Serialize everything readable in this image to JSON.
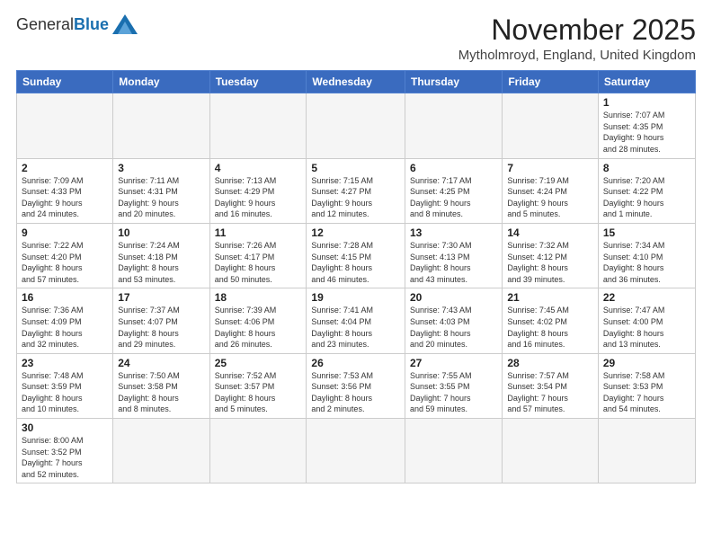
{
  "header": {
    "logo_general": "General",
    "logo_blue": "Blue",
    "month_title": "November 2025",
    "location": "Mytholmroyd, England, United Kingdom"
  },
  "days_of_week": [
    "Sunday",
    "Monday",
    "Tuesday",
    "Wednesday",
    "Thursday",
    "Friday",
    "Saturday"
  ],
  "weeks": [
    [
      {
        "day": "",
        "info": ""
      },
      {
        "day": "",
        "info": ""
      },
      {
        "day": "",
        "info": ""
      },
      {
        "day": "",
        "info": ""
      },
      {
        "day": "",
        "info": ""
      },
      {
        "day": "",
        "info": ""
      },
      {
        "day": "1",
        "info": "Sunrise: 7:07 AM\nSunset: 4:35 PM\nDaylight: 9 hours\nand 28 minutes."
      }
    ],
    [
      {
        "day": "2",
        "info": "Sunrise: 7:09 AM\nSunset: 4:33 PM\nDaylight: 9 hours\nand 24 minutes."
      },
      {
        "day": "3",
        "info": "Sunrise: 7:11 AM\nSunset: 4:31 PM\nDaylight: 9 hours\nand 20 minutes."
      },
      {
        "day": "4",
        "info": "Sunrise: 7:13 AM\nSunset: 4:29 PM\nDaylight: 9 hours\nand 16 minutes."
      },
      {
        "day": "5",
        "info": "Sunrise: 7:15 AM\nSunset: 4:27 PM\nDaylight: 9 hours\nand 12 minutes."
      },
      {
        "day": "6",
        "info": "Sunrise: 7:17 AM\nSunset: 4:25 PM\nDaylight: 9 hours\nand 8 minutes."
      },
      {
        "day": "7",
        "info": "Sunrise: 7:19 AM\nSunset: 4:24 PM\nDaylight: 9 hours\nand 5 minutes."
      },
      {
        "day": "8",
        "info": "Sunrise: 7:20 AM\nSunset: 4:22 PM\nDaylight: 9 hours\nand 1 minute."
      }
    ],
    [
      {
        "day": "9",
        "info": "Sunrise: 7:22 AM\nSunset: 4:20 PM\nDaylight: 8 hours\nand 57 minutes."
      },
      {
        "day": "10",
        "info": "Sunrise: 7:24 AM\nSunset: 4:18 PM\nDaylight: 8 hours\nand 53 minutes."
      },
      {
        "day": "11",
        "info": "Sunrise: 7:26 AM\nSunset: 4:17 PM\nDaylight: 8 hours\nand 50 minutes."
      },
      {
        "day": "12",
        "info": "Sunrise: 7:28 AM\nSunset: 4:15 PM\nDaylight: 8 hours\nand 46 minutes."
      },
      {
        "day": "13",
        "info": "Sunrise: 7:30 AM\nSunset: 4:13 PM\nDaylight: 8 hours\nand 43 minutes."
      },
      {
        "day": "14",
        "info": "Sunrise: 7:32 AM\nSunset: 4:12 PM\nDaylight: 8 hours\nand 39 minutes."
      },
      {
        "day": "15",
        "info": "Sunrise: 7:34 AM\nSunset: 4:10 PM\nDaylight: 8 hours\nand 36 minutes."
      }
    ],
    [
      {
        "day": "16",
        "info": "Sunrise: 7:36 AM\nSunset: 4:09 PM\nDaylight: 8 hours\nand 32 minutes."
      },
      {
        "day": "17",
        "info": "Sunrise: 7:37 AM\nSunset: 4:07 PM\nDaylight: 8 hours\nand 29 minutes."
      },
      {
        "day": "18",
        "info": "Sunrise: 7:39 AM\nSunset: 4:06 PM\nDaylight: 8 hours\nand 26 minutes."
      },
      {
        "day": "19",
        "info": "Sunrise: 7:41 AM\nSunset: 4:04 PM\nDaylight: 8 hours\nand 23 minutes."
      },
      {
        "day": "20",
        "info": "Sunrise: 7:43 AM\nSunset: 4:03 PM\nDaylight: 8 hours\nand 20 minutes."
      },
      {
        "day": "21",
        "info": "Sunrise: 7:45 AM\nSunset: 4:02 PM\nDaylight: 8 hours\nand 16 minutes."
      },
      {
        "day": "22",
        "info": "Sunrise: 7:47 AM\nSunset: 4:00 PM\nDaylight: 8 hours\nand 13 minutes."
      }
    ],
    [
      {
        "day": "23",
        "info": "Sunrise: 7:48 AM\nSunset: 3:59 PM\nDaylight: 8 hours\nand 10 minutes."
      },
      {
        "day": "24",
        "info": "Sunrise: 7:50 AM\nSunset: 3:58 PM\nDaylight: 8 hours\nand 8 minutes."
      },
      {
        "day": "25",
        "info": "Sunrise: 7:52 AM\nSunset: 3:57 PM\nDaylight: 8 hours\nand 5 minutes."
      },
      {
        "day": "26",
        "info": "Sunrise: 7:53 AM\nSunset: 3:56 PM\nDaylight: 8 hours\nand 2 minutes."
      },
      {
        "day": "27",
        "info": "Sunrise: 7:55 AM\nSunset: 3:55 PM\nDaylight: 7 hours\nand 59 minutes."
      },
      {
        "day": "28",
        "info": "Sunrise: 7:57 AM\nSunset: 3:54 PM\nDaylight: 7 hours\nand 57 minutes."
      },
      {
        "day": "29",
        "info": "Sunrise: 7:58 AM\nSunset: 3:53 PM\nDaylight: 7 hours\nand 54 minutes."
      }
    ],
    [
      {
        "day": "30",
        "info": "Sunrise: 8:00 AM\nSunset: 3:52 PM\nDaylight: 7 hours\nand 52 minutes."
      },
      {
        "day": "",
        "info": ""
      },
      {
        "day": "",
        "info": ""
      },
      {
        "day": "",
        "info": ""
      },
      {
        "day": "",
        "info": ""
      },
      {
        "day": "",
        "info": ""
      },
      {
        "day": "",
        "info": ""
      }
    ]
  ]
}
